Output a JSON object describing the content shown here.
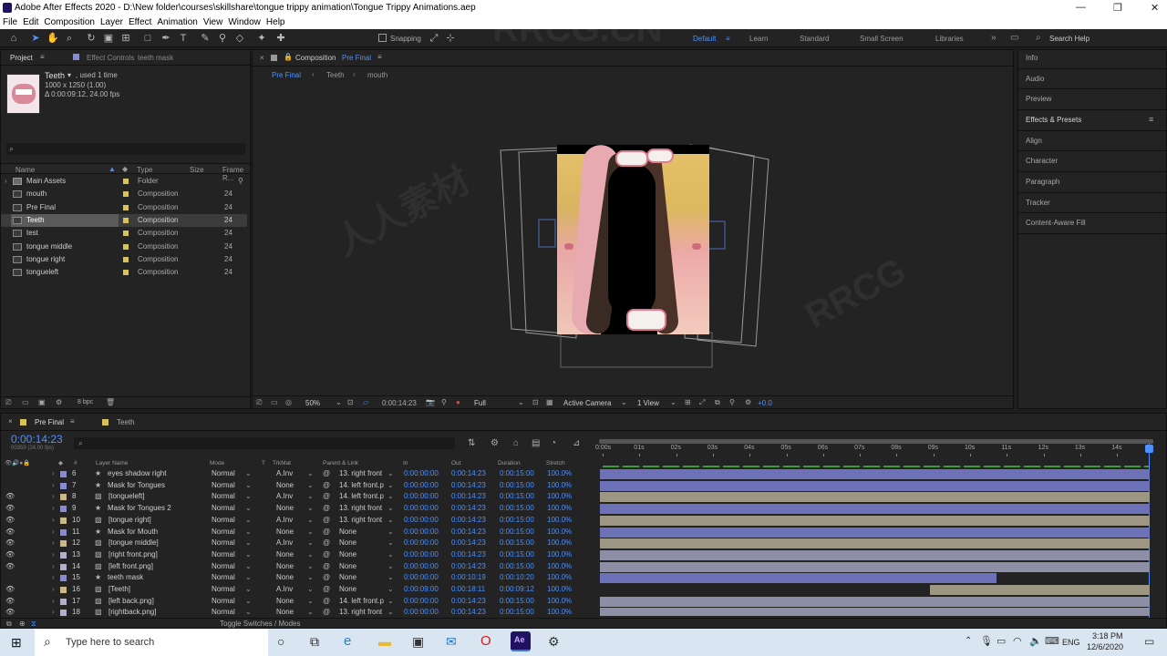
{
  "window": {
    "title": "Adobe After Effects 2020 - D:\\New folder\\courses\\skillshare\\tongue trippy animation\\Tongue Trippy Animations.aep"
  },
  "menu": [
    "File",
    "Edit",
    "Composition",
    "Layer",
    "Effect",
    "Animation",
    "View",
    "Window",
    "Help"
  ],
  "toolbar": {
    "snapping_label": "Snapping",
    "workspaces": [
      "Default",
      "Learn",
      "Standard",
      "Small Screen",
      "Libraries"
    ],
    "search_placeholder": "Search Help"
  },
  "project": {
    "tab_label": "Project",
    "effect_controls_tab": "Effect Controls",
    "effect_controls_target": "teeth mask",
    "selected_name": "Teeth",
    "selected_usage": ", used 1 time",
    "selected_dims": "1000 x 1250 (1.00)",
    "selected_duration": "Δ 0:00:09:12, 24.00 fps",
    "columns": [
      "Name",
      "Type",
      "Size",
      "Frame R..."
    ],
    "items": [
      {
        "name": "Main Assets",
        "type": "Folder",
        "fr": "",
        "color": "#d8c25a"
      },
      {
        "name": "mouth",
        "type": "Composition",
        "fr": "24",
        "color": "#d8c25a"
      },
      {
        "name": "Pre Final",
        "type": "Composition",
        "fr": "24",
        "color": "#d8c25a"
      },
      {
        "name": "Teeth",
        "type": "Composition",
        "fr": "24",
        "color": "#d8c25a"
      },
      {
        "name": "test",
        "type": "Composition",
        "fr": "24",
        "color": "#d8c25a"
      },
      {
        "name": "tongue middle",
        "type": "Composition",
        "fr": "24",
        "color": "#d8c25a"
      },
      {
        "name": "tongue right",
        "type": "Composition",
        "fr": "24",
        "color": "#d8c25a"
      },
      {
        "name": "tongueleft",
        "type": "Composition",
        "fr": "24",
        "color": "#d8c25a"
      }
    ],
    "bpc": "8 bpc"
  },
  "viewer": {
    "tab_prefix": "Composition",
    "tab_name": "Pre Final",
    "breadcrumbs": [
      "Pre Final",
      "Teeth",
      "mouth"
    ],
    "zoom": "50%",
    "timecode": "0:00:14:23",
    "resolution": "Full",
    "camera": "Active Camera",
    "view": "1 View",
    "exposure": "+0.0"
  },
  "right_panels": [
    "Info",
    "Audio",
    "Preview",
    "Effects & Presets",
    "Align",
    "Character",
    "Paragraph",
    "Tracker",
    "Content-Aware Fill"
  ],
  "timeline": {
    "tabs": [
      "Pre Final",
      "Teeth"
    ],
    "timecode": "0:00:14:23",
    "frame_info": "00359 (24.00 fps)",
    "columns": [
      "#",
      "Layer Name",
      "Mode",
      "T",
      "TrkMat",
      "Parent & Link",
      "In",
      "Out",
      "Duration",
      "Stretch"
    ],
    "ruler": [
      "0:00s",
      "01s",
      "02s",
      "03s",
      "04s",
      "05s",
      "06s",
      "07s",
      "08s",
      "09s",
      "10s",
      "11s",
      "12s",
      "13s",
      "14s"
    ],
    "toggle_label": "Toggle Switches / Modes",
    "layers": [
      {
        "num": "6",
        "name": "eyes shadow right",
        "mode": "Normal",
        "trk": "A.Inv",
        "parent": "13. right front",
        "in": "0:00:00:00",
        "out": "0:00:14:23",
        "dur": "0:00:15:00",
        "str": "100.0%",
        "color": "#8a8ad0",
        "bar_start": 0,
        "bar_end": 15,
        "bar_color": "#6d72b8"
      },
      {
        "num": "7",
        "name": "Mask for Tongues",
        "mode": "Normal",
        "trk": "None",
        "parent": "14. left front.p",
        "in": "0:00:00:00",
        "out": "0:00:14:23",
        "dur": "0:00:15:00",
        "str": "100.0%",
        "color": "#8a8ad0",
        "bar_start": 0,
        "bar_end": 15,
        "bar_color": "#6d72b8"
      },
      {
        "num": "8",
        "name": "[tongueleft]",
        "mode": "Normal",
        "trk": "A.Inv",
        "parent": "14. left front.p",
        "in": "0:00:00:00",
        "out": "0:00:14:23",
        "dur": "0:00:15:00",
        "str": "100.0%",
        "color": "#c9b88a",
        "bar_start": 0,
        "bar_end": 15,
        "bar_color": "#9c9683"
      },
      {
        "num": "9",
        "name": "Mask for Tongues 2",
        "mode": "Normal",
        "trk": "None",
        "parent": "13. right front",
        "in": "0:00:00:00",
        "out": "0:00:14:23",
        "dur": "0:00:15:00",
        "str": "100.0%",
        "color": "#8a8ad0",
        "bar_start": 0,
        "bar_end": 15,
        "bar_color": "#6d72b8"
      },
      {
        "num": "10",
        "name": "[tongue right]",
        "mode": "Normal",
        "trk": "A.Inv",
        "parent": "13. right front",
        "in": "0:00:00:00",
        "out": "0:00:14:23",
        "dur": "0:00:15:00",
        "str": "100.0%",
        "color": "#c9b88a",
        "bar_start": 0,
        "bar_end": 15,
        "bar_color": "#9c9683"
      },
      {
        "num": "11",
        "name": "Mask for Mouth",
        "mode": "Normal",
        "trk": "None",
        "parent": "None",
        "in": "0:00:00:00",
        "out": "0:00:14:23",
        "dur": "0:00:15:00",
        "str": "100.0%",
        "color": "#8a8ad0",
        "bar_start": 0,
        "bar_end": 15,
        "bar_color": "#6d72b8"
      },
      {
        "num": "12",
        "name": "[tongue middle]",
        "mode": "Normal",
        "trk": "A.Inv",
        "parent": "None",
        "in": "0:00:00:00",
        "out": "0:00:14:23",
        "dur": "0:00:15:00",
        "str": "100.0%",
        "color": "#c9b88a",
        "bar_start": 0,
        "bar_end": 15,
        "bar_color": "#9c9683"
      },
      {
        "num": "13",
        "name": "[right front.png]",
        "mode": "Normal",
        "trk": "None",
        "parent": "None",
        "in": "0:00:00:00",
        "out": "0:00:14:23",
        "dur": "0:00:15:00",
        "str": "100.0%",
        "color": "#b0b0c8",
        "bar_start": 0,
        "bar_end": 15,
        "bar_color": "#8c8fa6"
      },
      {
        "num": "14",
        "name": "[left front.png]",
        "mode": "Normal",
        "trk": "None",
        "parent": "None",
        "in": "0:00:00:00",
        "out": "0:00:14:23",
        "dur": "0:00:15:00",
        "str": "100.0%",
        "color": "#b0b0c8",
        "bar_start": 0,
        "bar_end": 15,
        "bar_color": "#8c8fa6"
      },
      {
        "num": "15",
        "name": "teeth mask",
        "mode": "Normal",
        "trk": "None",
        "parent": "None",
        "in": "0:00:00:00",
        "out": "0:00:10:19",
        "dur": "0:00:10:20",
        "str": "100.0%",
        "color": "#8a8ad0",
        "bar_start": 0,
        "bar_end": 10.83,
        "bar_color": "#6d72b8"
      },
      {
        "num": "16",
        "name": "[Teeth]",
        "mode": "Normal",
        "trk": "A.Inv",
        "parent": "None",
        "in": "0:00:09:00",
        "out": "0:00:18:11",
        "dur": "0:00:09:12",
        "str": "100.0%",
        "color": "#c9b88a",
        "bar_start": 9,
        "bar_end": 15,
        "bar_color": "#9c9683"
      },
      {
        "num": "17",
        "name": "[left back.png]",
        "mode": "Normal",
        "trk": "None",
        "parent": "14. left front.p",
        "in": "0:00:00:00",
        "out": "0:00:14:23",
        "dur": "0:00:15:00",
        "str": "100.0%",
        "color": "#b0b0c8",
        "bar_start": 0,
        "bar_end": 15,
        "bar_color": "#8c8fa6"
      },
      {
        "num": "18",
        "name": "[rightback.png]",
        "mode": "Normal",
        "trk": "None",
        "parent": "13. right front",
        "in": "0:00:00:00",
        "out": "0:00:14:23",
        "dur": "0:00:15:00",
        "str": "100.0%",
        "color": "#b0b0c8",
        "bar_start": 0,
        "bar_end": 15,
        "bar_color": "#8c8fa6"
      }
    ]
  },
  "taskbar": {
    "search_placeholder": "Type here to search",
    "lang": "ENG",
    "time": "3:18 PM",
    "date": "12/6/2020"
  },
  "watermarks": [
    "RRCG.CN",
    "人人素材",
    "RRCG"
  ]
}
